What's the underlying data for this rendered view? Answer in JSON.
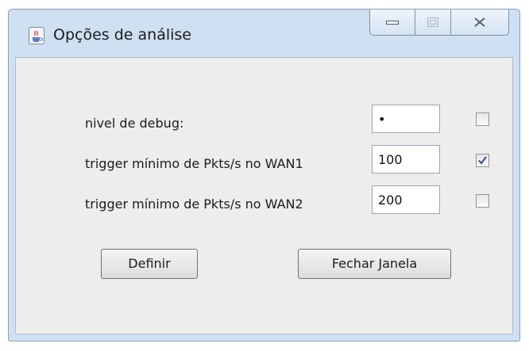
{
  "window": {
    "title": "Opções de análise",
    "icons": {
      "app": "java-coffee-cup-icon",
      "minimize": "minimize-icon",
      "maximize": "maximize-icon",
      "close": "close-icon"
    }
  },
  "form": {
    "rows": [
      {
        "label": "nivel de debug:",
        "value": "•",
        "checked": false
      },
      {
        "label": "trigger mínimo de Pkts/s no WAN1",
        "value": "100",
        "checked": true
      },
      {
        "label": "trigger mínimo de Pkts/s no WAN2",
        "value": "200",
        "checked": false
      }
    ]
  },
  "buttons": {
    "define": "Definir",
    "close_window": "Fechar Janela"
  }
}
